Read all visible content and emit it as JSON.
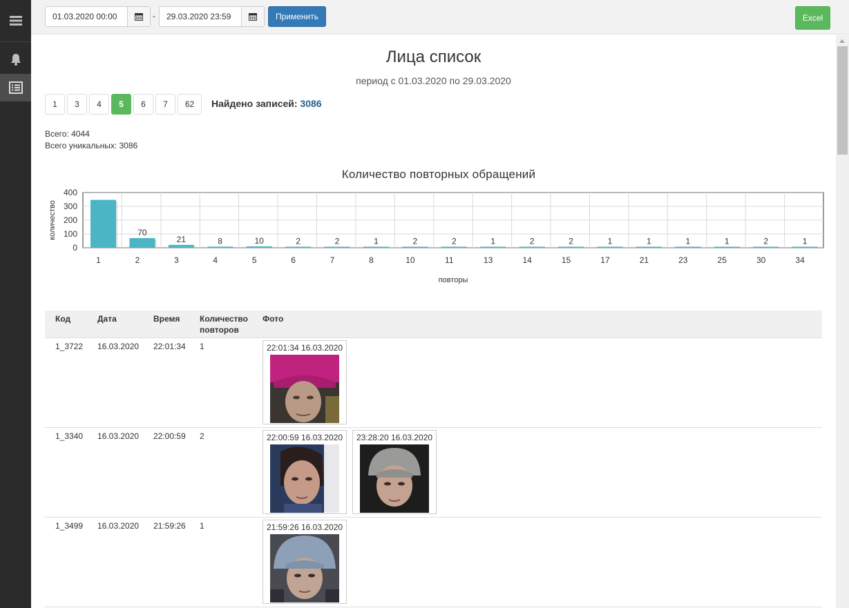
{
  "sidebar": {
    "items": [
      {
        "icon": "menu-icon"
      },
      {
        "icon": "bell-icon"
      },
      {
        "icon": "list-icon",
        "active": true
      }
    ]
  },
  "toolbar": {
    "date_from": "01.03.2020 00:00",
    "date_separator": "-",
    "date_to": "29.03.2020 23:59",
    "apply_label": "Применить",
    "excel_label": "Excel",
    "accent": "#337ab7",
    "excel_color": "#5cb85c"
  },
  "page": {
    "title": "Лица список",
    "subtitle": "период с 01.03.2020 по 29.03.2020"
  },
  "pager": {
    "pages": [
      "1",
      "3",
      "4",
      "5",
      "6",
      "7",
      "62"
    ],
    "active": "5",
    "found_label": "Найдено записей:",
    "found_count": "3086"
  },
  "totals": {
    "total_line": "Всего: 4044",
    "unique_line": "Всего уникальных: 3086"
  },
  "chart_data": {
    "type": "bar",
    "title": "Количество повторных обращений",
    "xlabel": "повторы",
    "ylabel": "количество",
    "categories": [
      "1",
      "2",
      "3",
      "4",
      "5",
      "6",
      "7",
      "8",
      "10",
      "11",
      "13",
      "14",
      "15",
      "17",
      "21",
      "23",
      "25",
      "30",
      "34"
    ],
    "values": [
      347,
      70,
      21,
      8,
      10,
      2,
      2,
      1,
      2,
      2,
      1,
      2,
      2,
      1,
      1,
      1,
      1,
      2,
      1
    ],
    "labels": [
      "",
      "70",
      "21",
      "8",
      "10",
      "2",
      "2",
      "1",
      "2",
      "2",
      "1",
      "2",
      "2",
      "1",
      "1",
      "1",
      "1",
      "2",
      "1"
    ],
    "yticks": [
      "0",
      "100",
      "200",
      "300",
      "400"
    ],
    "ylim": [
      0,
      400
    ],
    "grid": true,
    "bar_color": "#4bb5c6"
  },
  "table": {
    "headers": {
      "code": "Код",
      "date": "Дата",
      "time": "Время",
      "count_1": "Количество",
      "count_2": "повторов",
      "photo": "Фото"
    },
    "rows": [
      {
        "code": "1_3722",
        "date": "16.03.2020",
        "time": "22:01:34",
        "count": "1",
        "photos": [
          {
            "caption": "22:01:34 16.03.2020"
          }
        ]
      },
      {
        "code": "1_3340",
        "date": "16.03.2020",
        "time": "22:00:59",
        "count": "2",
        "photos": [
          {
            "caption": "22:00:59 16.03.2020"
          },
          {
            "caption": "23:28:20 16.03.2020"
          }
        ]
      },
      {
        "code": "1_3499",
        "date": "16.03.2020",
        "time": "21:59:26",
        "count": "1",
        "photos": [
          {
            "caption": "21:59:26 16.03.2020"
          }
        ]
      }
    ]
  }
}
